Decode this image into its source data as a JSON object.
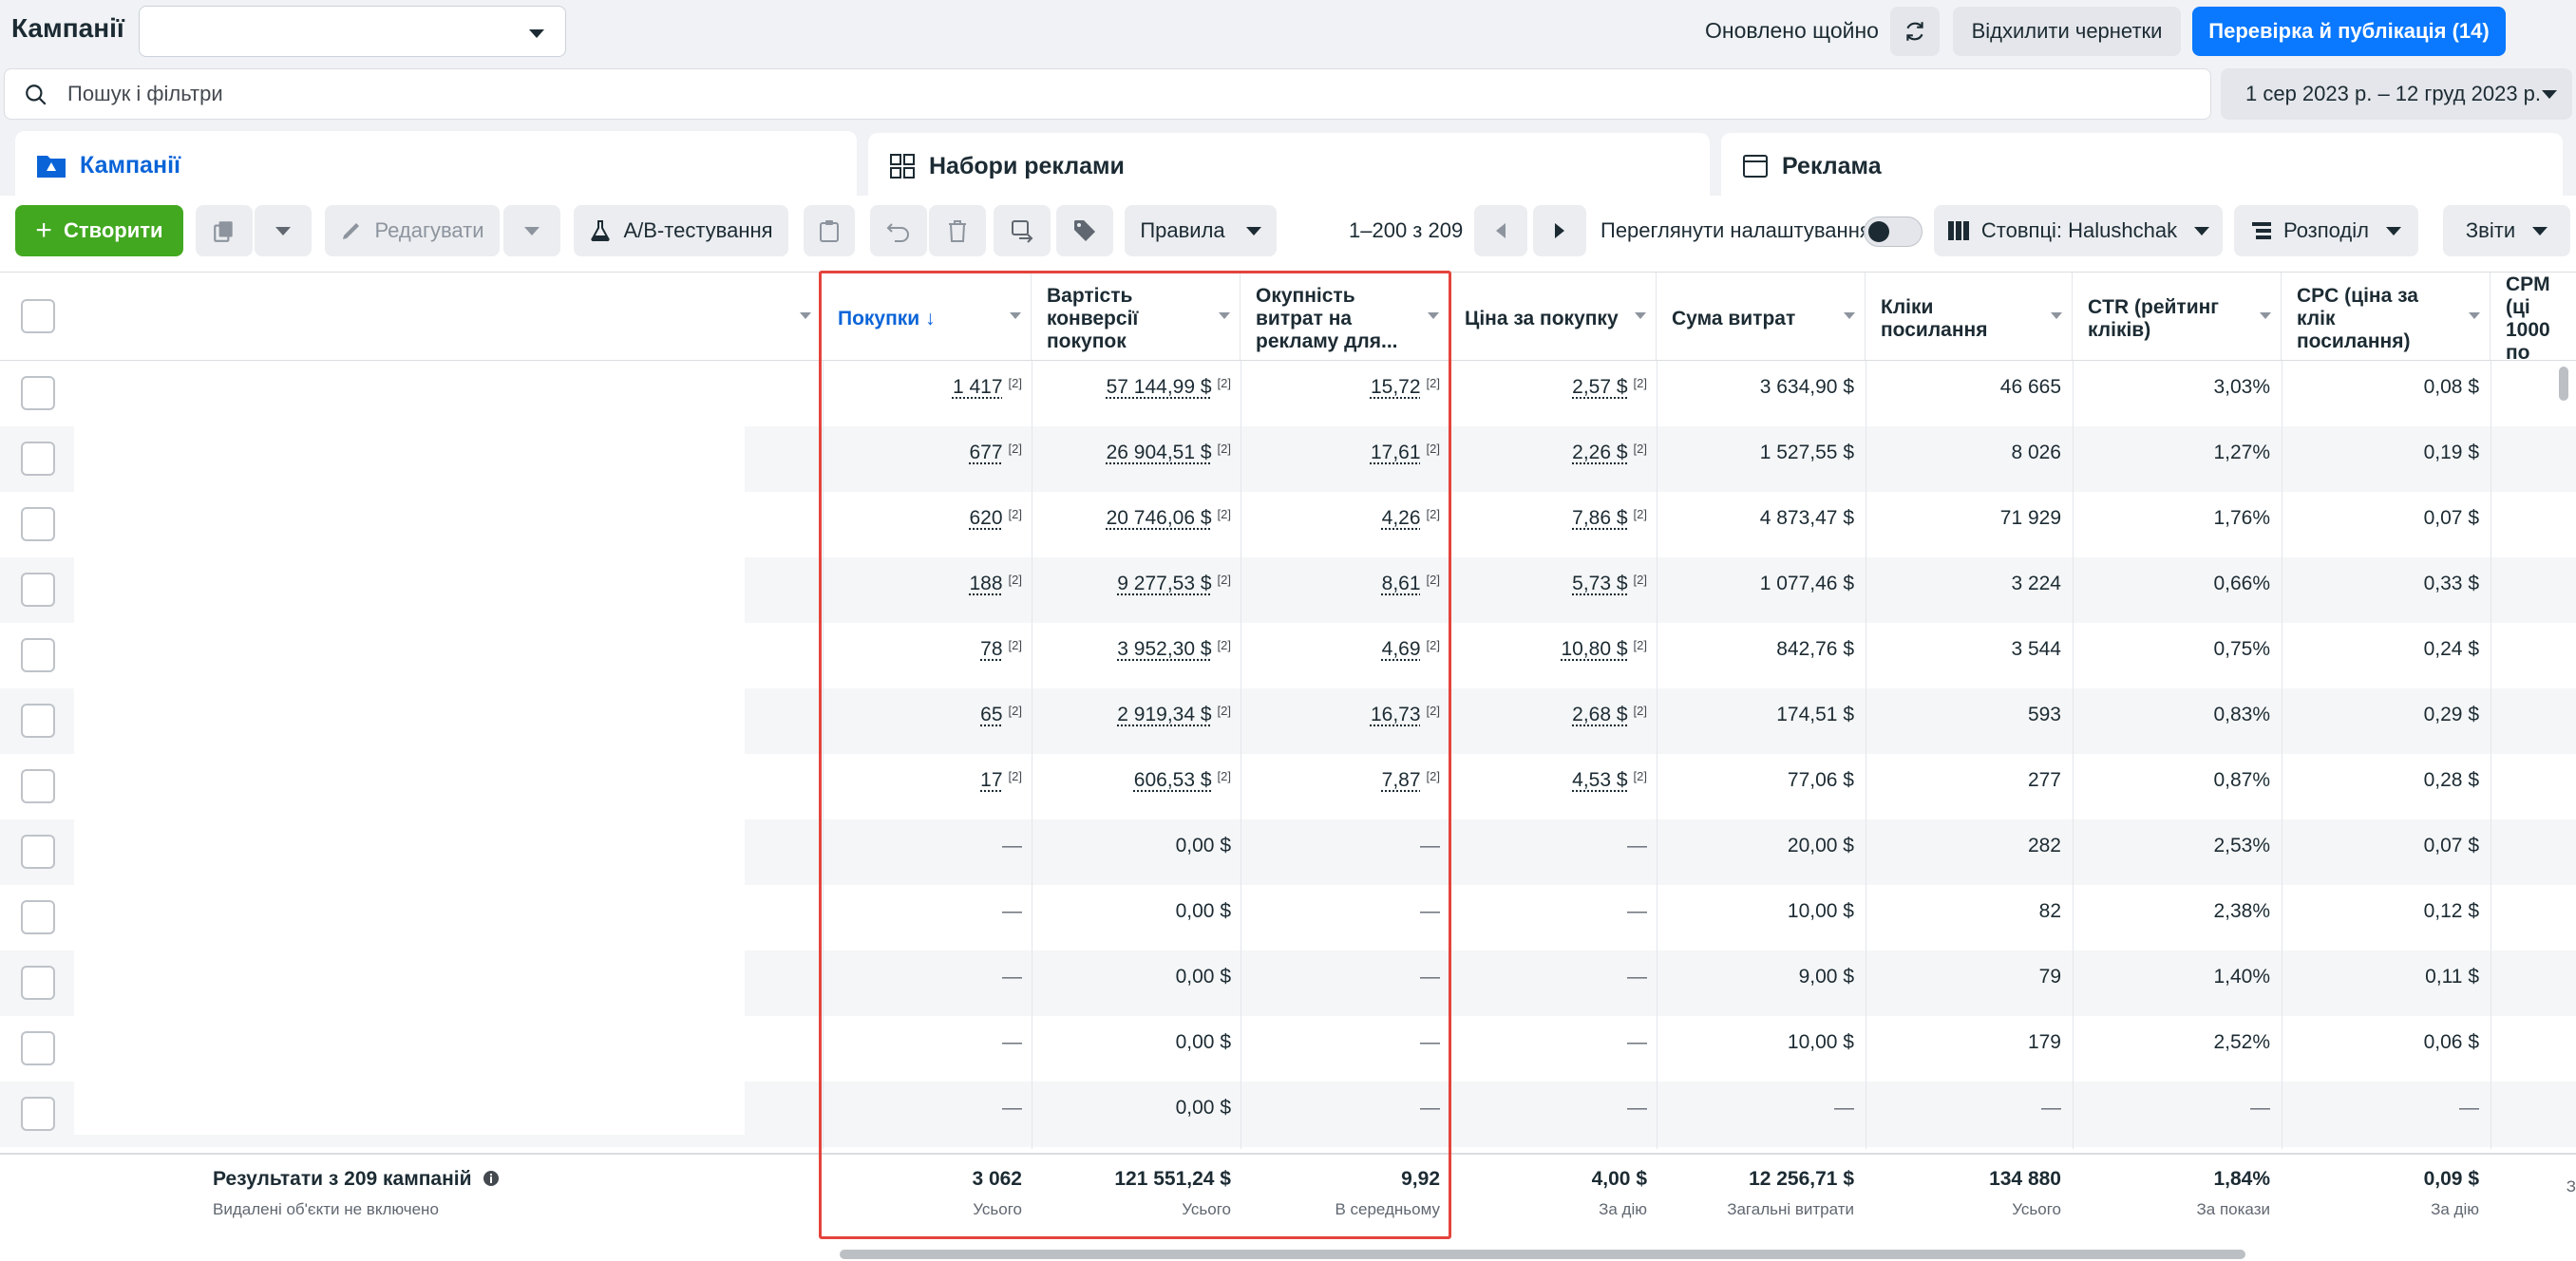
{
  "header": {
    "title": "Кампанії",
    "campaign_select_value": "",
    "updated": "Оновлено щойно",
    "discard_drafts": "Відхилити чернетки",
    "review_publish": "Перевірка й публікація (14)"
  },
  "search": {
    "placeholder": "Пошук і фільтри",
    "date_range": "1 сер 2023 р. – 12 груд 2023 р."
  },
  "tabs": [
    {
      "label": "Кампанії",
      "icon": "folder-icon",
      "active": true
    },
    {
      "label": "Набори реклами",
      "icon": "grid-icon",
      "active": false
    },
    {
      "label": "Реклама",
      "icon": "ad-window-icon",
      "active": false
    }
  ],
  "toolbar": {
    "create": "Створити",
    "edit": "Редагувати",
    "ab_test": "A/B-тестування",
    "rules": "Правила",
    "pager": "1–200 з 209",
    "view_settings": "Переглянути налаштування",
    "columns": "Стовпці: Halushchak",
    "breakdown": "Розподіл",
    "reports": "Звіти"
  },
  "columns": [
    {
      "key": "purchases",
      "label": "Покупки ↓",
      "sorted": true
    },
    {
      "key": "purchase_value",
      "label": "Вартість конверсії покупок"
    },
    {
      "key": "roas",
      "label": "Окупність витрат на рекламу для..."
    },
    {
      "key": "cost_per_purchase",
      "label": "Ціна за покупку"
    },
    {
      "key": "spend",
      "label": "Сума витрат"
    },
    {
      "key": "link_clicks",
      "label": "Кліки посилання"
    },
    {
      "key": "ctr",
      "label": "CTR (рейтинг кліків)"
    },
    {
      "key": "cpc",
      "label": "CPC (ціна за клік посилання)"
    },
    {
      "key": "cpm",
      "label": "CPM (ці 1000 по"
    }
  ],
  "rows": [
    {
      "purchases": "1 417",
      "purchase_value": "57 144,99 $",
      "roas": "15,72",
      "cost_per_purchase": "2,57 $",
      "spend": "3 634,90 $",
      "link_clicks": "46 665",
      "ctr": "3,03%",
      "cpc": "0,08 $"
    },
    {
      "purchases": "677",
      "purchase_value": "26 904,51 $",
      "roas": "17,61",
      "cost_per_purchase": "2,26 $",
      "spend": "1 527,55 $",
      "link_clicks": "8 026",
      "ctr": "1,27%",
      "cpc": "0,19 $"
    },
    {
      "purchases": "620",
      "purchase_value": "20 746,06 $",
      "roas": "4,26",
      "cost_per_purchase": "7,86 $",
      "spend": "4 873,47 $",
      "link_clicks": "71 929",
      "ctr": "1,76%",
      "cpc": "0,07 $"
    },
    {
      "purchases": "188",
      "purchase_value": "9 277,53 $",
      "roas": "8,61",
      "cost_per_purchase": "5,73 $",
      "spend": "1 077,46 $",
      "link_clicks": "3 224",
      "ctr": "0,66%",
      "cpc": "0,33 $"
    },
    {
      "purchases": "78",
      "purchase_value": "3 952,30 $",
      "roas": "4,69",
      "cost_per_purchase": "10,80 $",
      "spend": "842,76 $",
      "link_clicks": "3 544",
      "ctr": "0,75%",
      "cpc": "0,24 $"
    },
    {
      "purchases": "65",
      "purchase_value": "2 919,34 $",
      "roas": "16,73",
      "cost_per_purchase": "2,68 $",
      "spend": "174,51 $",
      "link_clicks": "593",
      "ctr": "0,83%",
      "cpc": "0,29 $"
    },
    {
      "purchases": "17",
      "purchase_value": "606,53 $",
      "roas": "7,87",
      "cost_per_purchase": "4,53 $",
      "spend": "77,06 $",
      "link_clicks": "277",
      "ctr": "0,87%",
      "cpc": "0,28 $"
    },
    {
      "purchases": "—",
      "purchase_value": "0,00 $",
      "roas": "—",
      "cost_per_purchase": "—",
      "spend": "20,00 $",
      "link_clicks": "282",
      "ctr": "2,53%",
      "cpc": "0,07 $"
    },
    {
      "purchases": "—",
      "purchase_value": "0,00 $",
      "roas": "—",
      "cost_per_purchase": "—",
      "spend": "10,00 $",
      "link_clicks": "82",
      "ctr": "2,38%",
      "cpc": "0,12 $"
    },
    {
      "purchases": "—",
      "purchase_value": "0,00 $",
      "roas": "—",
      "cost_per_purchase": "—",
      "spend": "9,00 $",
      "link_clicks": "79",
      "ctr": "1,40%",
      "cpc": "0,11 $"
    },
    {
      "purchases": "—",
      "purchase_value": "0,00 $",
      "roas": "—",
      "cost_per_purchase": "—",
      "spend": "10,00 $",
      "link_clicks": "179",
      "ctr": "2,52%",
      "cpc": "0,06 $"
    },
    {
      "purchases": "—",
      "purchase_value": "0,00 $",
      "roas": "—",
      "cost_per_purchase": "—",
      "spend": "—",
      "link_clicks": "—",
      "ctr": "—",
      "cpc": "—"
    }
  ],
  "attribution_mark": "[2]",
  "footer": {
    "title": "Результати з 209 кампаній",
    "subtitle": "Видалені об'єкти не включено",
    "cells": [
      {
        "value": "3 062",
        "sub": "Усього"
      },
      {
        "value": "121 551,24 $",
        "sub": "Усього"
      },
      {
        "value": "9,92",
        "sub": "В середньому"
      },
      {
        "value": "4,00 $",
        "sub": "За дію"
      },
      {
        "value": "12 256,71 $",
        "sub": "Загальні витрати"
      },
      {
        "value": "134 880",
        "sub": "Усього"
      },
      {
        "value": "1,84%",
        "sub": "За покази"
      },
      {
        "value": "0,09 $",
        "sub": "За дію"
      },
      {
        "value": "",
        "sub": "З"
      }
    ]
  },
  "colors": {
    "primary": "#0a78ff",
    "create": "#42a820",
    "highlight": "#e4443c"
  }
}
